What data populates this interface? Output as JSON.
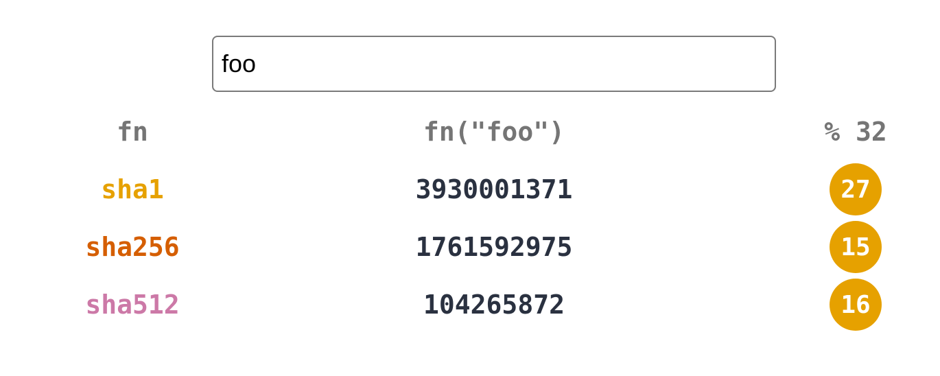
{
  "search": {
    "value": "foo"
  },
  "table": {
    "headers": {
      "fn": "fn",
      "result": "fn(\"foo\")",
      "mod": "% 32"
    },
    "rows": [
      {
        "fn": "sha1",
        "fn_color": "#e6a100",
        "value": "3930001371",
        "mod": "27"
      },
      {
        "fn": "sha256",
        "fn_color": "#d55e00",
        "value": "1761592975",
        "mod": "15"
      },
      {
        "fn": "sha512",
        "fn_color": "#cc79a7",
        "value": "104265872",
        "mod": "16"
      }
    ]
  },
  "colors": {
    "badge": "#e6a100",
    "header_text": "#757575",
    "value_text": "#2a3140"
  }
}
